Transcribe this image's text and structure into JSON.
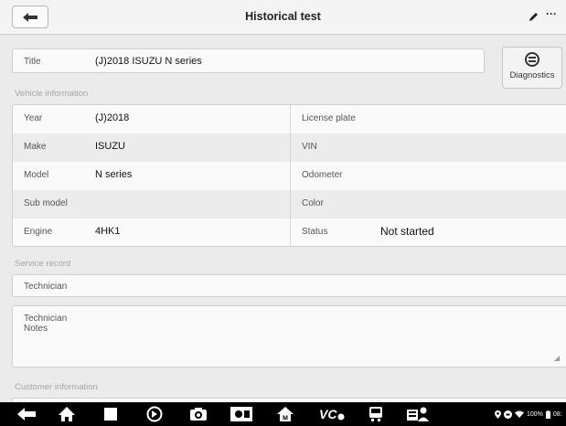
{
  "header": {
    "title": "Historical test"
  },
  "test_info": {
    "title_label": "Title",
    "title_value": "(J)2018 ISUZU N series",
    "diagnostics_label": "Diagnostics"
  },
  "vehicle_information": {
    "section_label": "Vehicle information",
    "rows": [
      {
        "left_label": "Year",
        "left_value": "(J)2018",
        "right_label": "License plate",
        "right_value": ""
      },
      {
        "left_label": "Make",
        "left_value": "ISUZU",
        "right_label": "VIN",
        "right_value": ""
      },
      {
        "left_label": "Model",
        "left_value": "N series",
        "right_label": "Odometer",
        "right_value": ""
      },
      {
        "left_label": "Sub model",
        "left_value": "",
        "right_label": "Color",
        "right_value": ""
      },
      {
        "left_label": "Engine",
        "left_value": "4HK1",
        "right_label": "Status",
        "right_value": "Not started"
      }
    ]
  },
  "service_record": {
    "section_label": "Service record",
    "technician_label": "Technician",
    "technician_notes_label_line1": "Technician",
    "technician_notes_label_line2": "Notes"
  },
  "customer_information": {
    "section_label": "Customer information"
  },
  "status_bar": {
    "battery_text": "100%",
    "time_text": "08:"
  },
  "colors": {
    "page_background": "#ebebeb",
    "panel_background": "#fafafa",
    "alt_row_background": "#ececec",
    "navbar_background": "#000000"
  }
}
